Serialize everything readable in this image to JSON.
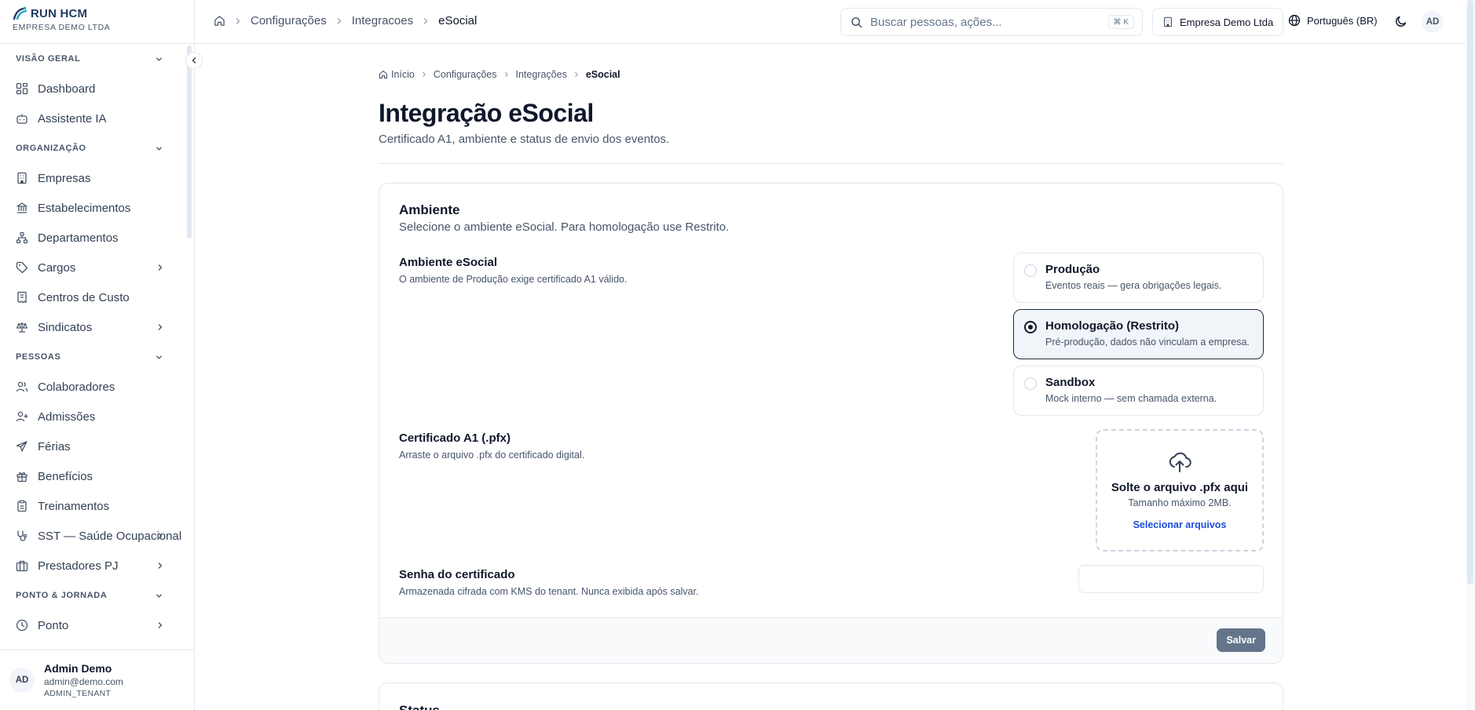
{
  "brand": {
    "name": "RUN HCM",
    "company": "EMPRESA DEMO LTDA"
  },
  "sidebar": {
    "sections": [
      {
        "title": "VISÃO GERAL",
        "items": [
          {
            "label": "Dashboard",
            "icon": "dashboard-icon",
            "has_children": false
          },
          {
            "label": "Assistente IA",
            "icon": "bot-icon",
            "has_children": false
          }
        ]
      },
      {
        "title": "ORGANIZAÇÃO",
        "items": [
          {
            "label": "Empresas",
            "icon": "building-icon",
            "has_children": false
          },
          {
            "label": "Estabelecimentos",
            "icon": "landmark-icon",
            "has_children": false
          },
          {
            "label": "Departamentos",
            "icon": "network-icon",
            "has_children": false
          },
          {
            "label": "Cargos",
            "icon": "tag-icon",
            "has_children": true
          },
          {
            "label": "Centros de Custo",
            "icon": "receipt-icon",
            "has_children": false
          },
          {
            "label": "Sindicatos",
            "icon": "scale-icon",
            "has_children": true
          }
        ]
      },
      {
        "title": "PESSOAS",
        "items": [
          {
            "label": "Colaboradores",
            "icon": "users-icon",
            "has_children": false
          },
          {
            "label": "Admissões",
            "icon": "user-plus-icon",
            "has_children": false
          },
          {
            "label": "Férias",
            "icon": "plane-icon",
            "has_children": false
          },
          {
            "label": "Benefícios",
            "icon": "gift-icon",
            "has_children": false
          },
          {
            "label": "Treinamentos",
            "icon": "clipboard-icon",
            "has_children": false
          },
          {
            "label": "SST — Saúde Ocupacional",
            "icon": "stethoscope-icon",
            "has_children": true
          },
          {
            "label": "Prestadores PJ",
            "icon": "briefcase-icon",
            "has_children": true
          }
        ]
      },
      {
        "title": "PONTO & JORNADA",
        "items": [
          {
            "label": "Ponto",
            "icon": "clock-icon",
            "has_children": true
          }
        ]
      }
    ]
  },
  "user": {
    "initials": "AD",
    "name": "Admin Demo",
    "email": "admin@demo.com",
    "role": "ADMIN_TENANT"
  },
  "topbar": {
    "breadcrumb": [
      "Configurações",
      "Integracoes",
      "eSocial"
    ],
    "search_placeholder": "Buscar pessoas, ações...",
    "search_shortcut": "⌘ K",
    "company": "Empresa Demo Ltda",
    "language": "Português (BR)",
    "avatar": "AD"
  },
  "page": {
    "breadcrumb": [
      "Início",
      "Configurações",
      "Integrações",
      "eSocial"
    ],
    "title": "Integração eSocial",
    "subtitle": "Certificado A1, ambiente e status de envio dos eventos."
  },
  "ambiente_card": {
    "title": "Ambiente",
    "description": "Selecione o ambiente eSocial. Para homologação use Restrito.",
    "env_field": {
      "label": "Ambiente eSocial",
      "help": "O ambiente de Produção exige certificado A1 válido."
    },
    "options": [
      {
        "title": "Produção",
        "desc": "Eventos reais — gera obrigações legais.",
        "selected": false
      },
      {
        "title": "Homologação (Restrito)",
        "desc": "Pré-produção, dados não vinculam a empresa.",
        "selected": true
      },
      {
        "title": "Sandbox",
        "desc": "Mock interno — sem chamada externa.",
        "selected": false
      }
    ],
    "cert_field": {
      "label": "Certificado A1 (.pfx)",
      "help": "Arraste o arquivo .pfx do certificado digital."
    },
    "dropzone": {
      "title": "Solte o arquivo .pfx aqui",
      "subtitle": "Tamanho máximo 2MB.",
      "link": "Selecionar arquivos"
    },
    "password_field": {
      "label": "Senha do certificado",
      "help": "Armazenada cifrada com KMS do tenant. Nunca exibida após salvar.",
      "value": ""
    },
    "save_label": "Salvar"
  },
  "status_card": {
    "title": "Status"
  }
}
